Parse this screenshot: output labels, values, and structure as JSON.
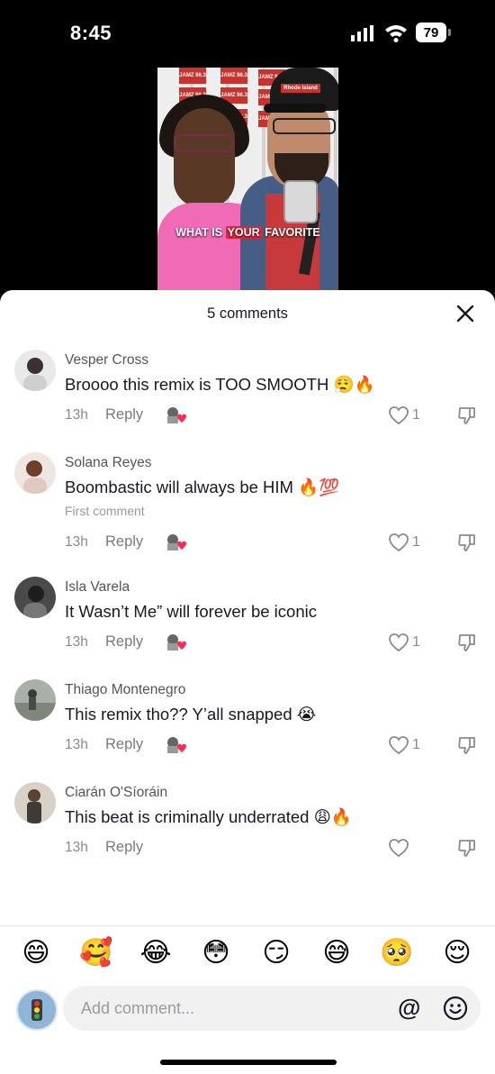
{
  "status_bar": {
    "time": "8:45",
    "battery": "79"
  },
  "video": {
    "caption_prefix": "WHAT IS ",
    "caption_highlight": "YOUR",
    "caption_suffix": " FAVORITE",
    "backdrop_logo": "JAMZ 96.3",
    "cap_logo": "Rhode Island"
  },
  "sheet": {
    "title": "5 comments"
  },
  "comments": [
    {
      "name": "Vesper Cross",
      "text": "Broooo this remix is TOO SMOOTH 😮‍💨🔥",
      "time": "13h",
      "reply": "Reply",
      "likes": "1",
      "first": ""
    },
    {
      "name": "Solana Reyes",
      "text": "Boombastic will always be HIM 🔥💯",
      "time": "13h",
      "reply": "Reply",
      "likes": "1",
      "first": "First comment"
    },
    {
      "name": "Isla Varela",
      "text": "It Wasn’t Me” will forever be iconic",
      "time": "13h",
      "reply": "Reply",
      "likes": "1",
      "first": ""
    },
    {
      "name": "Thiago Montenegro",
      "text": "This remix tho?? Y’all snapped 😭",
      "time": "13h",
      "reply": "Reply",
      "likes": "1",
      "first": ""
    },
    {
      "name": "Ciarán O'Síoráin",
      "text": "This beat is criminally underrated 😩🔥",
      "time": "13h",
      "reply": "Reply",
      "likes": "",
      "first": ""
    }
  ],
  "emojis": [
    "😄",
    "🥰",
    "😂",
    "😳",
    "😏",
    "😅",
    "🥺",
    "😌"
  ],
  "composer": {
    "placeholder": "Add comment...",
    "at": "@"
  }
}
